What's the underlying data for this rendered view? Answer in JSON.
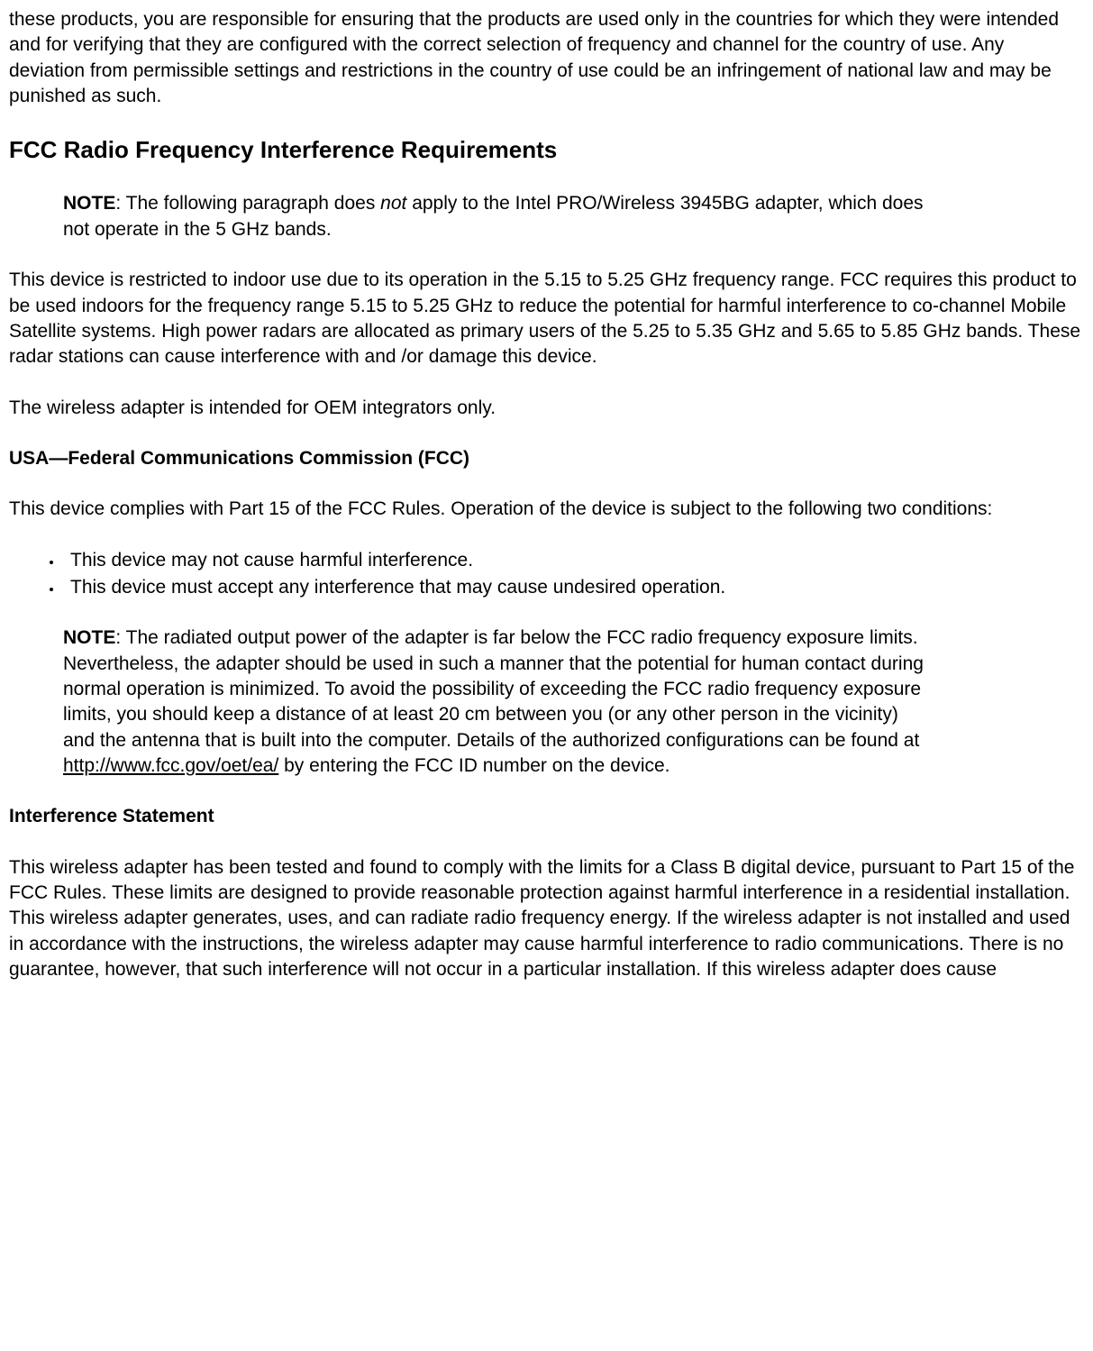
{
  "intro_paragraph": "these products, you are responsible for ensuring that the products are used only in the countries for which they were intended and for verifying that they are configured with the correct selection of frequency and channel for the country of use. Any deviation from permissible settings and restrictions in the country of use could be an infringement of national law and may be punished as such.",
  "heading_fcc_radio": "FCC Radio Frequency Interference Requirements",
  "note1": {
    "label": "NOTE",
    "pre": ": The following paragraph does ",
    "italic": "not",
    "post": " apply to the Intel PRO/Wireless 3945BG adapter, which does not operate in the 5 GHz bands."
  },
  "para_indoor": "This device is restricted to indoor use due to its operation in the 5.15 to 5.25 GHz frequency range. FCC requires this product to be used indoors for the frequency range 5.15 to 5.25 GHz to reduce the potential for harmful interference to co-channel Mobile Satellite systems. High power radars are allocated as primary users of the 5.25 to 5.35 GHz and 5.65 to 5.85 GHz bands. These radar stations can cause interference with and /or damage this device.",
  "para_oem": "The wireless adapter is intended for OEM integrators only.",
  "heading_usa_fcc": "USA—Federal Communications Commission (FCC)",
  "para_complies": "This device complies with Part 15 of the FCC Rules. Operation of the device is subject to the following two conditions:",
  "bullets": [
    "This device may not cause harmful interference.",
    "This device must accept any interference that may cause undesired operation."
  ],
  "note2": {
    "label": "NOTE",
    "pre": ": The radiated output power of the adapter is far below the FCC radio frequency exposure limits. Nevertheless, the adapter should be used in such a manner that the potential for human contact during normal operation is minimized. To avoid the possibility of exceeding the FCC radio frequency exposure limits, you should keep a distance of at least 20 cm between you (or any other person in the vicinity) and the antenna that is built into the computer. Details of the authorized configurations can be found at ",
    "link_text": "http://www.fcc.gov/oet/ea/",
    "post": " by entering the FCC ID number on the device."
  },
  "heading_interference": "Interference Statement",
  "para_interference": "This wireless adapter has been tested and found to comply with the limits for a Class B digital device, pursuant to Part 15 of the FCC Rules. These limits are designed to provide reasonable protection against harmful interference in a residential installation. This wireless adapter generates, uses, and can radiate radio frequency energy. If the wireless adapter is not installed and used in accordance with the instructions, the wireless adapter may cause harmful interference to radio communications. There is no guarantee, however, that such interference will not occur in a particular installation. If this wireless adapter does cause"
}
